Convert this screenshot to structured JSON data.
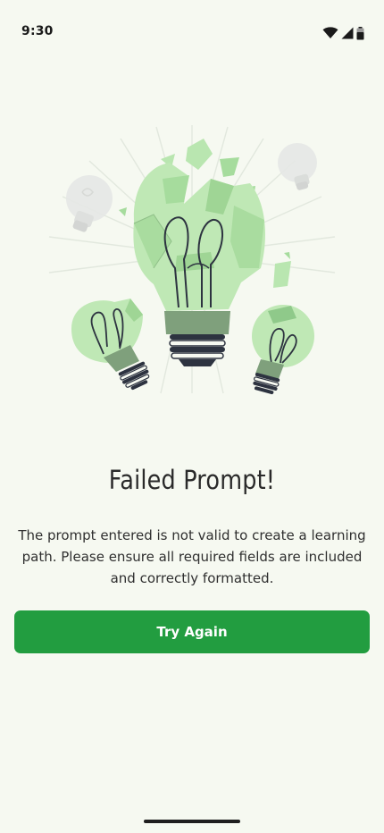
{
  "status_bar": {
    "time": "9:30",
    "icons": [
      "wifi-icon",
      "cellular-signal-icon",
      "battery-icon"
    ]
  },
  "illustration": {
    "name": "broken-lightbulb-illustration",
    "colors": {
      "light_green": "#b9e6b0",
      "medium_green": "#8fce8a",
      "dark_green": "#7fa07c",
      "outline": "#2d3340",
      "ray": "#e2e8de",
      "ghost_bulb": "#e4e6e4"
    }
  },
  "content": {
    "title": "Failed Prompt!",
    "message": "The prompt entered is not valid to create a learning path. Please ensure all required fields are included and correctly formatted."
  },
  "actions": {
    "try_again_label": "Try Again"
  },
  "theme": {
    "background": "#f6f9f1",
    "accent": "#229d40"
  }
}
